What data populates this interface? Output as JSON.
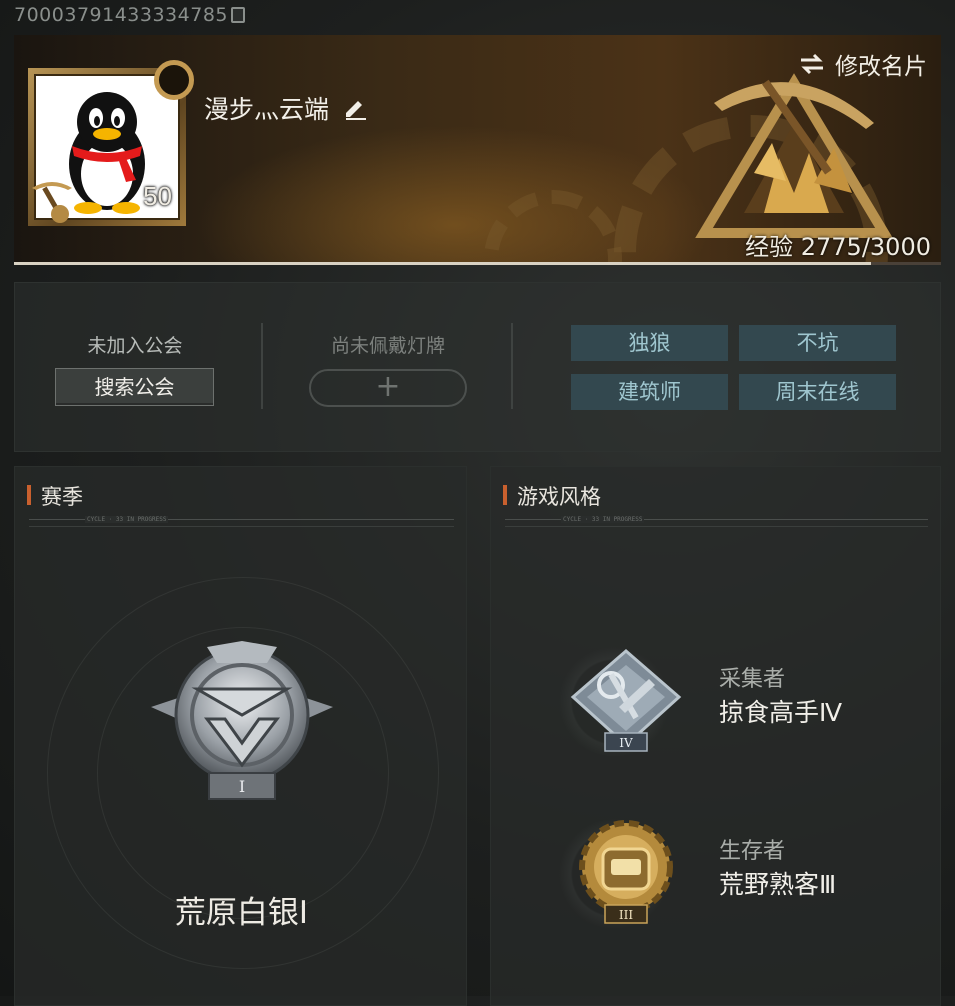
{
  "uid": {
    "text": "70003791433334785"
  },
  "profile": {
    "name": "漫步灬云端",
    "level": "50",
    "rename_label": "修改名片",
    "exp_label": "经验 2775/3000",
    "exp_progress": 0.925
  },
  "guild": {
    "status": "未加入公会",
    "search_label": "搜索公会"
  },
  "light_plate": {
    "status": "尚未佩戴灯牌",
    "add_label": "+"
  },
  "tags": [
    "独狼",
    "不坑",
    "建筑师",
    "周末在线"
  ],
  "season": {
    "title": "赛季",
    "divider_text": "CYCLE · 33 IN PROGRESS",
    "rank_name": "荒原白银Ⅰ",
    "badge_numeral": "I"
  },
  "play_style": {
    "title": "游戏风格",
    "divider_text": "CYCLE · 33 IN PROGRESS",
    "items": [
      {
        "category": "采集者",
        "title": "掠食高手Ⅳ",
        "numeral": "IV"
      },
      {
        "category": "生存者",
        "title": "荒野熟客Ⅲ",
        "numeral": "III"
      }
    ]
  },
  "colors": {
    "accent": "#c9602e",
    "tag_bg": "#33484f",
    "tag_text": "#9fc6cf",
    "gold": "#c49a52"
  }
}
